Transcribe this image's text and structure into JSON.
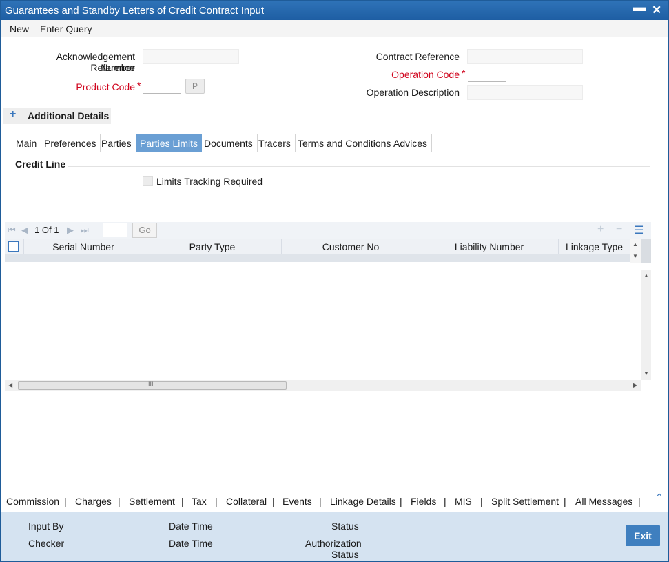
{
  "window": {
    "title": "Guarantees and Standby Letters of Credit Contract Input"
  },
  "menu": {
    "new": "New",
    "enter_query": "Enter Query"
  },
  "form": {
    "ack_ref_line1": "Acknowledgement Reference",
    "ack_ref_line2": "Number",
    "product_code": "Product Code",
    "product_button": "P",
    "contract_reference": "Contract Reference",
    "operation_code": "Operation Code",
    "operation_description": "Operation Description",
    "required_mark": "*"
  },
  "additional_details": {
    "icon": "+",
    "label": "Additional Details"
  },
  "tabs": [
    "Main",
    "Preferences",
    "Parties",
    "Parties Limits",
    "Documents",
    "Tracers",
    "Terms and Conditions",
    "Advices"
  ],
  "active_tab": "Parties Limits",
  "credit_line": {
    "title": "Credit Line",
    "limits_tracking_label": "Limits Tracking Required"
  },
  "grid": {
    "page_current": "1",
    "page_of": "Of",
    "page_total": "1",
    "go_label": "Go",
    "columns": [
      "Serial Number",
      "Party Type",
      "Customer No",
      "Liability Number",
      "Linkage Type"
    ],
    "scroll_thumb_label": "III"
  },
  "bottom_links": [
    "Commission",
    "Charges",
    "Settlement",
    "Tax",
    "Collateral",
    "Events",
    "Linkage Details",
    "Fields",
    "MIS",
    "Split Settlement",
    "All Messages"
  ],
  "footer": {
    "input_by": "Input By",
    "date_time": "Date Time",
    "status": "Status",
    "checker": "Checker",
    "auth_status_line1": "Authorization",
    "auth_status_line2": "Status",
    "exit": "Exit"
  }
}
